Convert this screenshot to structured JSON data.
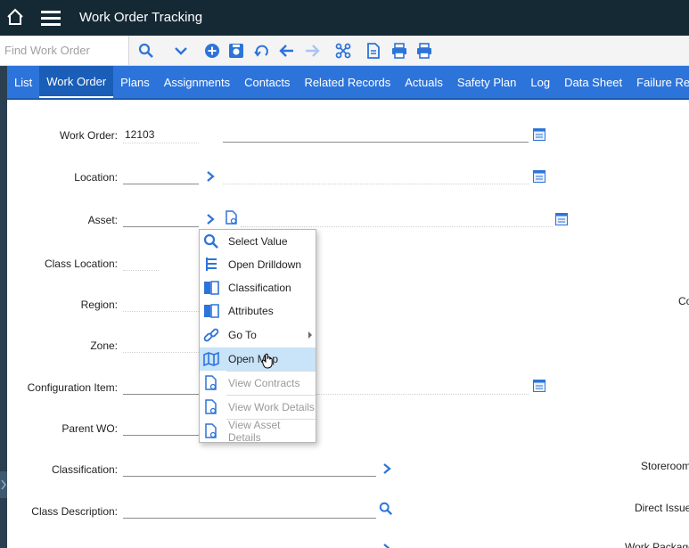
{
  "app": {
    "title": "Work Order Tracking",
    "home_icon": "home-icon",
    "menu_icon": "hamburger-menu-icon"
  },
  "toolbar": {
    "find_placeholder": "Find Work Order",
    "icons": [
      "search-icon",
      "chevron-down-icon",
      "new-record-icon",
      "save-icon",
      "undo-icon",
      "previous-icon",
      "next-icon",
      "workflow-icon",
      "report-icon",
      "print-icon",
      "print-alt-icon"
    ]
  },
  "tabs": [
    "List",
    "Work Order",
    "Plans",
    "Assignments",
    "Contacts",
    "Related Records",
    "Actuals",
    "Safety Plan",
    "Log",
    "Data Sheet",
    "Failure Re"
  ],
  "active_tab": "Work Order",
  "form": {
    "work_order_label": "Work Order:",
    "work_order_value": "12103",
    "location_label": "Location:",
    "asset_label": "Asset:",
    "class_location_label": "Class Location:",
    "region_label": "Region:",
    "zone_label": "Zone:",
    "configuration_item_label": "Configuration Item:",
    "parent_wo_label": "Parent WO:",
    "classification_label": "Classification:",
    "class_description_label": "Class Description:",
    "right_co_label": "Co",
    "storeroom_label": "Storeroom",
    "direct_issue_label": "Direct Issue",
    "work_package_label": "Work Package"
  },
  "context_menu": {
    "items": [
      {
        "label": "Select Value",
        "icon": "select-value-icon",
        "enabled": true
      },
      {
        "label": "Open Drilldown",
        "icon": "drilldown-icon",
        "enabled": true
      },
      {
        "label": "Classification",
        "icon": "classification-book-icon",
        "enabled": true
      },
      {
        "label": "Attributes",
        "icon": "attributes-book-icon",
        "enabled": true
      },
      {
        "label": "Go To",
        "icon": "link-icon",
        "enabled": true,
        "submenu": true
      },
      {
        "label": "Open Map",
        "icon": "map-icon",
        "enabled": true,
        "hovered": true
      },
      {
        "label": "View Contracts",
        "icon": "view-document-icon",
        "enabled": false
      },
      {
        "label": "View Work Details",
        "icon": "view-document-icon",
        "enabled": false
      },
      {
        "label": "View Asset Details",
        "icon": "view-document-icon",
        "enabled": false
      }
    ]
  },
  "colors": {
    "header_bg": "#152935",
    "tab_bg": "#2d74da",
    "accent": "#2d74da",
    "menu_hover": "#c9e3f8"
  }
}
